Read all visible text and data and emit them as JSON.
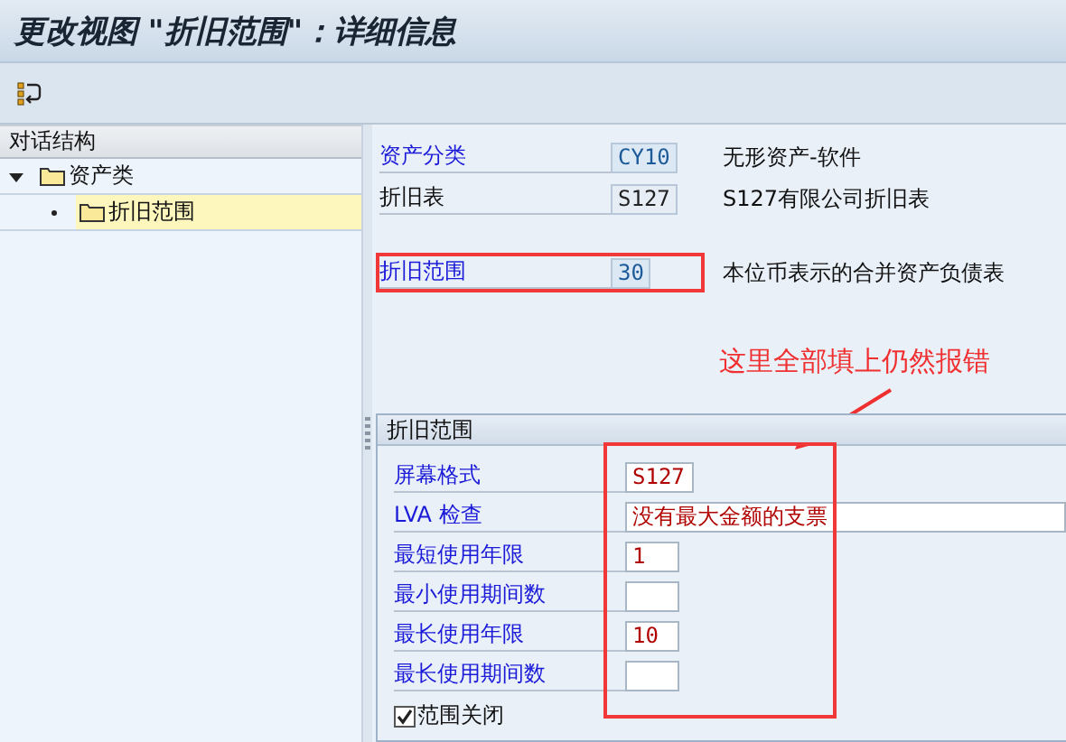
{
  "window": {
    "title": "更改视图 \"折旧范围\"：详细信息"
  },
  "dialog_structure": {
    "title": "对话结构",
    "items": [
      {
        "label": "资产类",
        "expanded": true,
        "selected": false,
        "children": [
          {
            "label": "折旧范围",
            "selected": true
          }
        ]
      }
    ]
  },
  "header_fields": [
    {
      "label": "资产分类",
      "linked": true,
      "value": "CY10",
      "editable": false,
      "description": "无形资产-软件",
      "highlighted": false
    },
    {
      "label": "折旧表",
      "linked": false,
      "value": "S127",
      "editable": false,
      "description": "S127有限公司折旧表",
      "highlighted": false
    },
    {
      "label": "折旧范围",
      "linked": true,
      "value": "30",
      "editable": false,
      "description": "本位币表示的合并资产负债表",
      "highlighted": true
    }
  ],
  "annotation": {
    "note": "这里全部填上仍然报错"
  },
  "group": {
    "title": "折旧范围",
    "highlighted": true,
    "fields": [
      {
        "label": "屏幕格式",
        "kind": "code",
        "value": "S127"
      },
      {
        "label": "LVA 检查",
        "kind": "long",
        "value": "没有最大金额的支票"
      },
      {
        "label": "最短使用年限",
        "kind": "number",
        "value": "1"
      },
      {
        "label": "最小使用期间数",
        "kind": "number"
      },
      {
        "label": "最长使用年限",
        "kind": "number",
        "value": "10"
      },
      {
        "label": "最长使用期间数",
        "kind": "number"
      }
    ],
    "checkbox": {
      "label": "范围关闭",
      "checked": true
    }
  }
}
